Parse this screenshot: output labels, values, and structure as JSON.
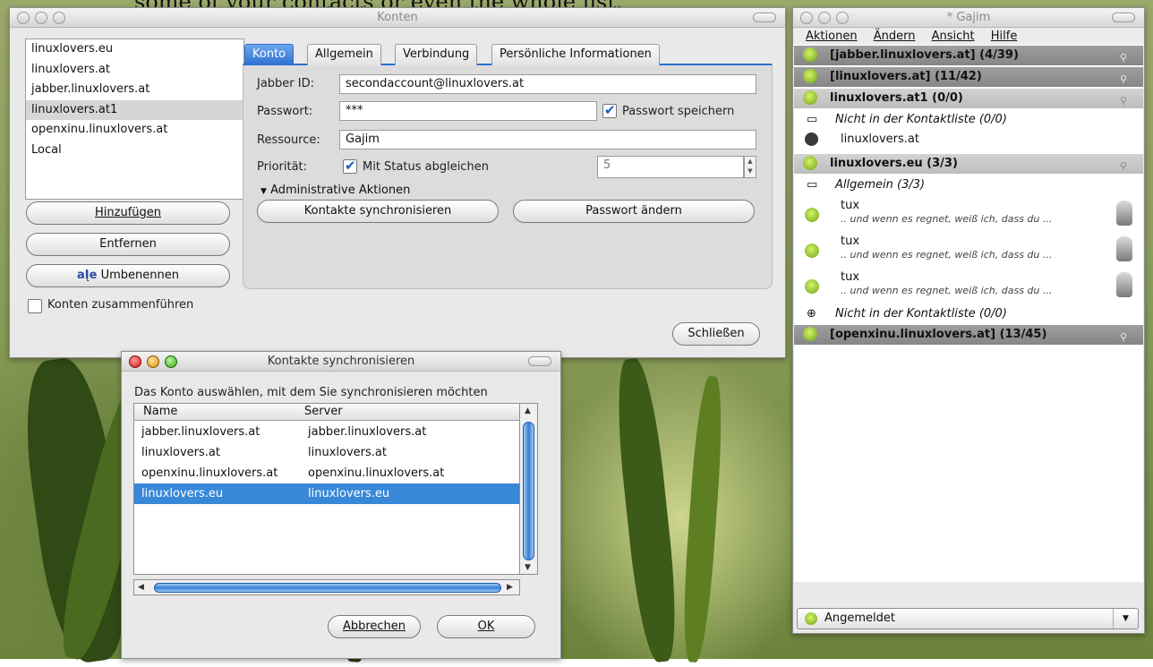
{
  "caption": "some of your contacts or even the whole list.",
  "konten": {
    "title": "Konten",
    "accounts": [
      "linuxlovers.eu",
      "linuxlovers.at",
      "jabber.linuxlovers.at",
      "linuxlovers.at1",
      "openxinu.linuxlovers.at",
      "Local"
    ],
    "selected_account": "linuxlovers.at1",
    "buttons": {
      "add": "Hinzufügen",
      "remove": "Entfernen",
      "rename": "Umbenennen",
      "close": "Schließen"
    },
    "merge_label": "Konten zusammenführen",
    "tabs": [
      "Konto",
      "Allgemein",
      "Verbindung",
      "Persönliche Informationen"
    ],
    "active_tab": "Konto",
    "jabber_id_label": "Jabber ID:",
    "jabber_id": "secondaccount@linuxlovers.at",
    "password_label": "Passwort:",
    "password": "***",
    "save_password_label": "Passwort speichern",
    "resource_label": "Ressource:",
    "resource": "Gajim",
    "priority_label": "Priorität:",
    "sync_status_label": "Mit Status abgleichen",
    "priority_value": "5",
    "admin_actions": "Administrative Aktionen",
    "sync_contacts_button": "Kontakte synchronisieren",
    "change_password_button": "Passwort ändern"
  },
  "gajim": {
    "title": "* Gajim",
    "menu": [
      "Aktionen",
      "Ändern",
      "Ansicht",
      "Hilfe"
    ],
    "groups": [
      "[jabber.linuxlovers.at] (4/39)",
      "[linuxlovers.at] (11/42)",
      "linuxlovers.at1 (0/0)",
      "linuxlovers.eu (3/3)",
      "[openxinu.linuxlovers.at] (13/45)"
    ],
    "not_in_list_1": "Nicht in der Kontaktliste (0/0)",
    "contact_offline": "linuxlovers.at",
    "group_general": "Allgemein (3/3)",
    "contacts": [
      {
        "name": "tux",
        "status": ".. und wenn es regnet, weiß ich, dass du ..."
      },
      {
        "name": "tux",
        "status": ".. und wenn es regnet, weiß ich, dass du ..."
      },
      {
        "name": "tux",
        "status": ".. und wenn es regnet, weiß ich, dass du ..."
      }
    ],
    "not_in_list_2": "Nicht in der Kontaktliste (0/0)",
    "status": "Angemeldet"
  },
  "sync": {
    "title": "Kontakte synchronisieren",
    "prompt": "Das Konto auswählen, mit dem Sie synchronisieren möchten",
    "columns": [
      "Name",
      "Server"
    ],
    "rows": [
      [
        "jabber.linuxlovers.at",
        "jabber.linuxlovers.at"
      ],
      [
        "linuxlovers.at",
        "linuxlovers.at"
      ],
      [
        "openxinu.linuxlovers.at",
        "openxinu.linuxlovers.at"
      ],
      [
        "linuxlovers.eu",
        "linuxlovers.eu"
      ]
    ],
    "selected_row": "linuxlovers.eu",
    "cancel": "Abbrechen",
    "ok": "OK"
  }
}
